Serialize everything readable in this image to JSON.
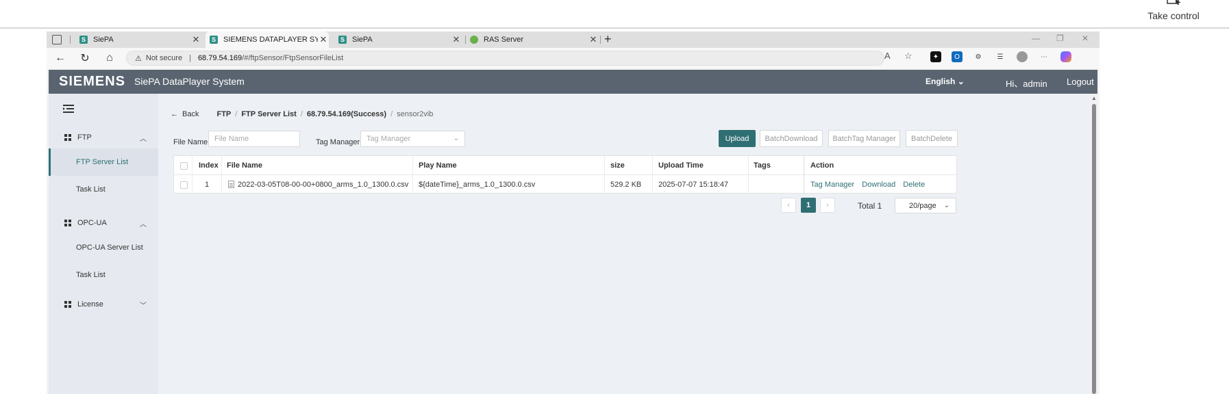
{
  "remote": {
    "take_control_label": "Take control"
  },
  "browser": {
    "tabs": [
      {
        "label": "SiePA",
        "favicon": "S"
      },
      {
        "label": "SIEMENS DATAPLAYER SYSTEM",
        "favicon": "S"
      },
      {
        "label": "SiePA",
        "favicon": "S"
      },
      {
        "label": "RAS Server",
        "favicon": ""
      }
    ],
    "new_tab_label": "+",
    "address": {
      "security_label": "Not secure",
      "host": "68.79.54.169",
      "path": "/#/ftpSensor/FtpSensorFileList"
    }
  },
  "app": {
    "brand": "SIEMENS",
    "title": "SiePA DataPlayer System",
    "language": "English",
    "greeting": "Hi、admin",
    "logout": "Logout"
  },
  "sidebar": {
    "groups": [
      {
        "label": "FTP",
        "items": [
          "FTP Server List",
          "Task List"
        ]
      },
      {
        "label": "OPC-UA",
        "items": [
          "OPC-UA Server List",
          "Task List"
        ]
      },
      {
        "label": "License",
        "items": []
      }
    ]
  },
  "breadcrumb": {
    "back": "Back",
    "items": [
      "FTP",
      "FTP Server List",
      "68.79.54.169(Success)",
      "sensor2vib"
    ]
  },
  "filters": {
    "file_name_label": "File Name",
    "file_name_placeholder": "File Name",
    "tag_manager_label": "Tag Manager",
    "tag_manager_placeholder": "Tag Manager"
  },
  "toolbar": {
    "upload": "Upload",
    "batch_download": "BatchDownload",
    "batch_tag_manager": "BatchTag Manager",
    "batch_delete": "BatchDelete"
  },
  "table": {
    "columns": [
      "Index",
      "File Name",
      "Play Name",
      "size",
      "Upload Time",
      "Tags",
      "Action"
    ],
    "rows": [
      {
        "index": "1",
        "file_name": "2022-03-05T08-00-00+0800_arms_1.0_1300.0.csv",
        "play_name": "${dateTime}_arms_1.0_1300.0.csv",
        "size": "529.2 KB",
        "upload_time": "2025-07-07 15:18:47",
        "tags": "",
        "actions": [
          "Tag Manager",
          "Download",
          "Delete"
        ]
      }
    ]
  },
  "pagination": {
    "prev": "‹",
    "current_page": "1",
    "next": "›",
    "total": "Total 1",
    "page_size": "20/page"
  },
  "colors": {
    "accent": "#2f6f73",
    "header_bg": "#5a6470",
    "sidebar_bg": "#e6e9ef",
    "content_bg": "#edf0f5"
  }
}
